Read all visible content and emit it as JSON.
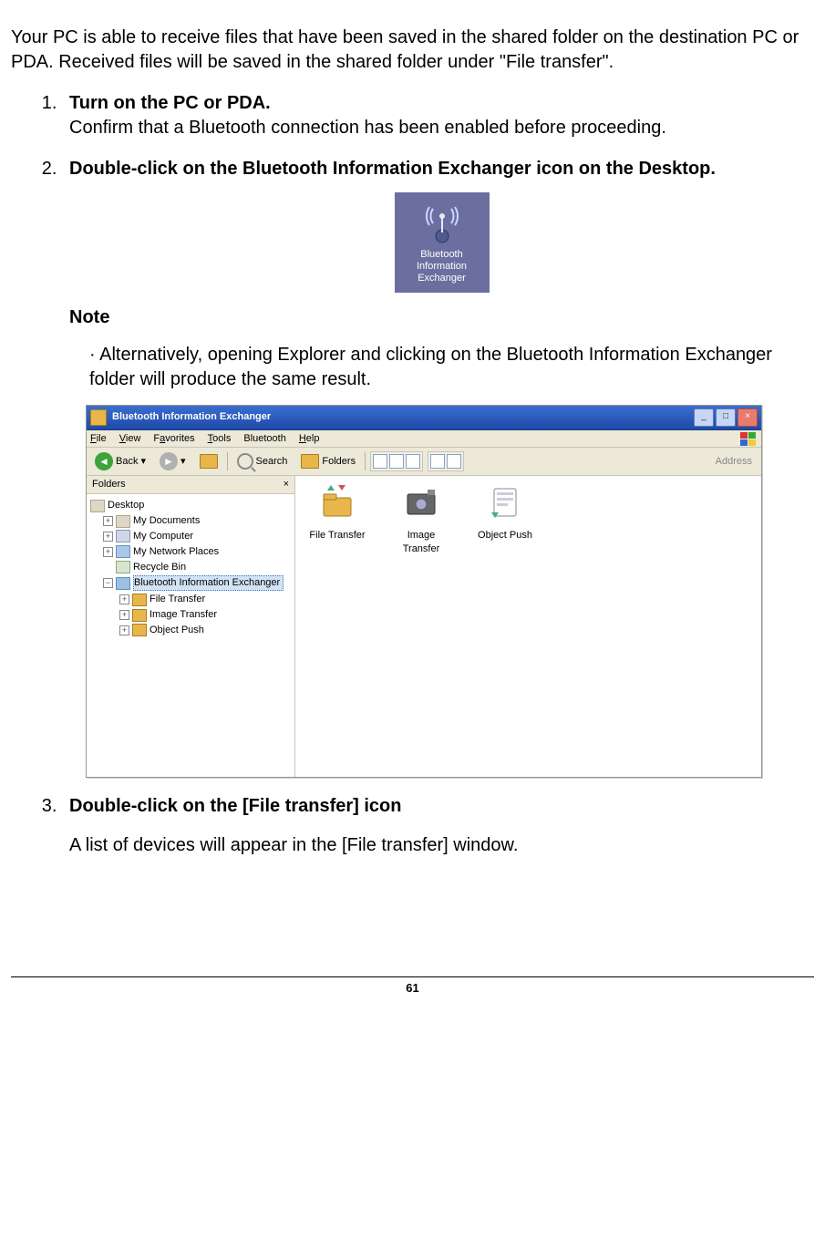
{
  "intro": "Your PC is able to receive files that have been saved in the shared folder on the destination PC or PDA. Received files will be saved in the shared folder under \"File transfer\".",
  "steps": [
    {
      "title": "Turn on the PC or PDA.",
      "text": "Confirm that a Bluetooth connection has been enabled before proceeding."
    },
    {
      "title": "Double-click on the Bluetooth Information Exchanger icon on the Desktop."
    },
    {
      "title": "Double-click on the [File transfer] icon",
      "text": "A list of devices will appear in the [File transfer] window."
    }
  ],
  "note": {
    "heading": "Note",
    "body_prefix": "· ",
    "body": "Alternatively, opening Explorer and clicking on the Bluetooth Information Exchanger folder will produce the same result."
  },
  "desktop_icon": {
    "label_l1": "Bluetooth",
    "label_l2": "Information",
    "label_l3": "Exchanger"
  },
  "explorer": {
    "title": "Bluetooth Information Exchanger",
    "menus": {
      "file": "File",
      "view": "View",
      "favorites": "Favorites",
      "tools": "Tools",
      "bluetooth": "Bluetooth",
      "help": "Help"
    },
    "toolbar": {
      "back": "Back",
      "search": "Search",
      "folders": "Folders",
      "address": "Address"
    },
    "sidebar": {
      "heading": "Folders",
      "close": "×",
      "items": {
        "desktop": "Desktop",
        "docs": "My Documents",
        "computer": "My Computer",
        "network": "My Network Places",
        "recycle": "Recycle Bin",
        "bt": "Bluetooth Information Exchanger",
        "ft": "File Transfer",
        "it": "Image Transfer",
        "op": "Object Push"
      }
    },
    "content": {
      "file_transfer": "File Transfer",
      "image_transfer": "Image Transfer",
      "object_push": "Object Push"
    }
  },
  "page_number": "61"
}
